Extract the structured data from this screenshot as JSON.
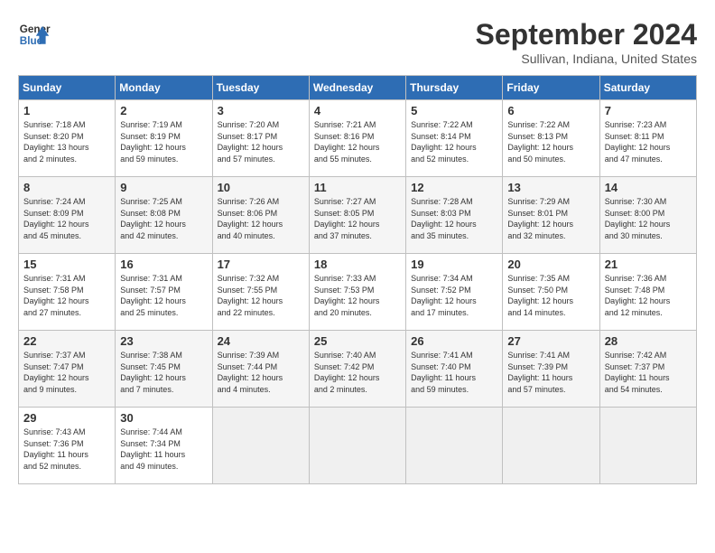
{
  "header": {
    "logo_line1": "General",
    "logo_line2": "Blue",
    "month": "September 2024",
    "location": "Sullivan, Indiana, United States"
  },
  "days_of_week": [
    "Sunday",
    "Monday",
    "Tuesday",
    "Wednesday",
    "Thursday",
    "Friday",
    "Saturday"
  ],
  "weeks": [
    [
      {
        "day": "1",
        "info": "Sunrise: 7:18 AM\nSunset: 8:20 PM\nDaylight: 13 hours\nand 2 minutes."
      },
      {
        "day": "2",
        "info": "Sunrise: 7:19 AM\nSunset: 8:19 PM\nDaylight: 12 hours\nand 59 minutes."
      },
      {
        "day": "3",
        "info": "Sunrise: 7:20 AM\nSunset: 8:17 PM\nDaylight: 12 hours\nand 57 minutes."
      },
      {
        "day": "4",
        "info": "Sunrise: 7:21 AM\nSunset: 8:16 PM\nDaylight: 12 hours\nand 55 minutes."
      },
      {
        "day": "5",
        "info": "Sunrise: 7:22 AM\nSunset: 8:14 PM\nDaylight: 12 hours\nand 52 minutes."
      },
      {
        "day": "6",
        "info": "Sunrise: 7:22 AM\nSunset: 8:13 PM\nDaylight: 12 hours\nand 50 minutes."
      },
      {
        "day": "7",
        "info": "Sunrise: 7:23 AM\nSunset: 8:11 PM\nDaylight: 12 hours\nand 47 minutes."
      }
    ],
    [
      {
        "day": "8",
        "info": "Sunrise: 7:24 AM\nSunset: 8:09 PM\nDaylight: 12 hours\nand 45 minutes."
      },
      {
        "day": "9",
        "info": "Sunrise: 7:25 AM\nSunset: 8:08 PM\nDaylight: 12 hours\nand 42 minutes."
      },
      {
        "day": "10",
        "info": "Sunrise: 7:26 AM\nSunset: 8:06 PM\nDaylight: 12 hours\nand 40 minutes."
      },
      {
        "day": "11",
        "info": "Sunrise: 7:27 AM\nSunset: 8:05 PM\nDaylight: 12 hours\nand 37 minutes."
      },
      {
        "day": "12",
        "info": "Sunrise: 7:28 AM\nSunset: 8:03 PM\nDaylight: 12 hours\nand 35 minutes."
      },
      {
        "day": "13",
        "info": "Sunrise: 7:29 AM\nSunset: 8:01 PM\nDaylight: 12 hours\nand 32 minutes."
      },
      {
        "day": "14",
        "info": "Sunrise: 7:30 AM\nSunset: 8:00 PM\nDaylight: 12 hours\nand 30 minutes."
      }
    ],
    [
      {
        "day": "15",
        "info": "Sunrise: 7:31 AM\nSunset: 7:58 PM\nDaylight: 12 hours\nand 27 minutes."
      },
      {
        "day": "16",
        "info": "Sunrise: 7:31 AM\nSunset: 7:57 PM\nDaylight: 12 hours\nand 25 minutes."
      },
      {
        "day": "17",
        "info": "Sunrise: 7:32 AM\nSunset: 7:55 PM\nDaylight: 12 hours\nand 22 minutes."
      },
      {
        "day": "18",
        "info": "Sunrise: 7:33 AM\nSunset: 7:53 PM\nDaylight: 12 hours\nand 20 minutes."
      },
      {
        "day": "19",
        "info": "Sunrise: 7:34 AM\nSunset: 7:52 PM\nDaylight: 12 hours\nand 17 minutes."
      },
      {
        "day": "20",
        "info": "Sunrise: 7:35 AM\nSunset: 7:50 PM\nDaylight: 12 hours\nand 14 minutes."
      },
      {
        "day": "21",
        "info": "Sunrise: 7:36 AM\nSunset: 7:48 PM\nDaylight: 12 hours\nand 12 minutes."
      }
    ],
    [
      {
        "day": "22",
        "info": "Sunrise: 7:37 AM\nSunset: 7:47 PM\nDaylight: 12 hours\nand 9 minutes."
      },
      {
        "day": "23",
        "info": "Sunrise: 7:38 AM\nSunset: 7:45 PM\nDaylight: 12 hours\nand 7 minutes."
      },
      {
        "day": "24",
        "info": "Sunrise: 7:39 AM\nSunset: 7:44 PM\nDaylight: 12 hours\nand 4 minutes."
      },
      {
        "day": "25",
        "info": "Sunrise: 7:40 AM\nSunset: 7:42 PM\nDaylight: 12 hours\nand 2 minutes."
      },
      {
        "day": "26",
        "info": "Sunrise: 7:41 AM\nSunset: 7:40 PM\nDaylight: 11 hours\nand 59 minutes."
      },
      {
        "day": "27",
        "info": "Sunrise: 7:41 AM\nSunset: 7:39 PM\nDaylight: 11 hours\nand 57 minutes."
      },
      {
        "day": "28",
        "info": "Sunrise: 7:42 AM\nSunset: 7:37 PM\nDaylight: 11 hours\nand 54 minutes."
      }
    ],
    [
      {
        "day": "29",
        "info": "Sunrise: 7:43 AM\nSunset: 7:36 PM\nDaylight: 11 hours\nand 52 minutes."
      },
      {
        "day": "30",
        "info": "Sunrise: 7:44 AM\nSunset: 7:34 PM\nDaylight: 11 hours\nand 49 minutes."
      },
      {
        "day": "",
        "info": ""
      },
      {
        "day": "",
        "info": ""
      },
      {
        "day": "",
        "info": ""
      },
      {
        "day": "",
        "info": ""
      },
      {
        "day": "",
        "info": ""
      }
    ]
  ]
}
